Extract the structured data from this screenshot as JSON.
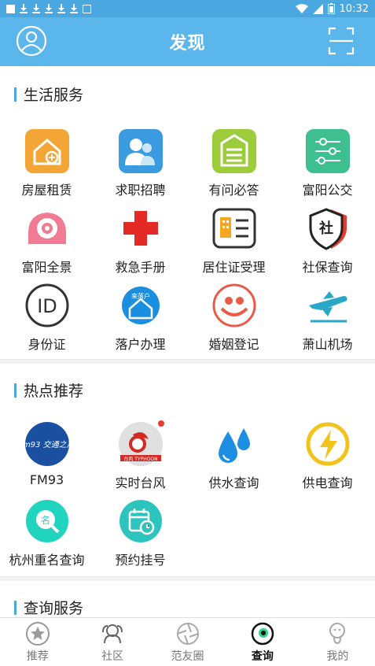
{
  "status_bar": {
    "time": "10:32"
  },
  "header": {
    "title": "发现"
  },
  "sections": [
    {
      "title": "生活服务",
      "items": [
        {
          "label": "房屋租赁",
          "icon": "house-rental-icon"
        },
        {
          "label": "求职招聘",
          "icon": "job-recruit-icon"
        },
        {
          "label": "有问必答",
          "icon": "qa-icon"
        },
        {
          "label": "富阳公交",
          "icon": "bus-icon"
        },
        {
          "label": "富阳全景",
          "icon": "panorama-icon"
        },
        {
          "label": "救急手册",
          "icon": "first-aid-icon"
        },
        {
          "label": "居住证受理",
          "icon": "residence-permit-icon"
        },
        {
          "label": "社保查询",
          "icon": "social-security-icon"
        },
        {
          "label": "身份证",
          "icon": "id-card-icon"
        },
        {
          "label": "落户办理",
          "icon": "household-icon"
        },
        {
          "label": "婚姻登记",
          "icon": "marriage-icon"
        },
        {
          "label": "萧山机场",
          "icon": "airport-icon"
        }
      ]
    },
    {
      "title": "热点推荐",
      "items": [
        {
          "label": "FM93",
          "icon": "fm93-icon",
          "badge": "fm93 交通之声"
        },
        {
          "label": "实时台风",
          "icon": "typhoon-icon",
          "badge": "台风 TYPHOON"
        },
        {
          "label": "供水查询",
          "icon": "water-icon"
        },
        {
          "label": "供电查询",
          "icon": "power-icon"
        },
        {
          "label": "杭州重名查询",
          "icon": "name-search-icon"
        },
        {
          "label": "预约挂号",
          "icon": "appointment-icon"
        }
      ]
    },
    {
      "title": "查询服务"
    }
  ],
  "icon_text": {
    "social": "社",
    "id": "ID",
    "household": "来落户",
    "name": "名"
  },
  "tabs": [
    {
      "label": "推荐",
      "icon": "star-icon",
      "active": false
    },
    {
      "label": "社区",
      "icon": "community-icon",
      "active": false
    },
    {
      "label": "范友圈",
      "icon": "aperture-icon",
      "active": false
    },
    {
      "label": "查询",
      "icon": "query-icon",
      "active": true
    },
    {
      "label": "我的",
      "icon": "profile-icon",
      "active": false
    }
  ],
  "colors": {
    "primary": "#5bb6ec",
    "accent": "#4aa7e0",
    "red": "#e83a2f"
  }
}
